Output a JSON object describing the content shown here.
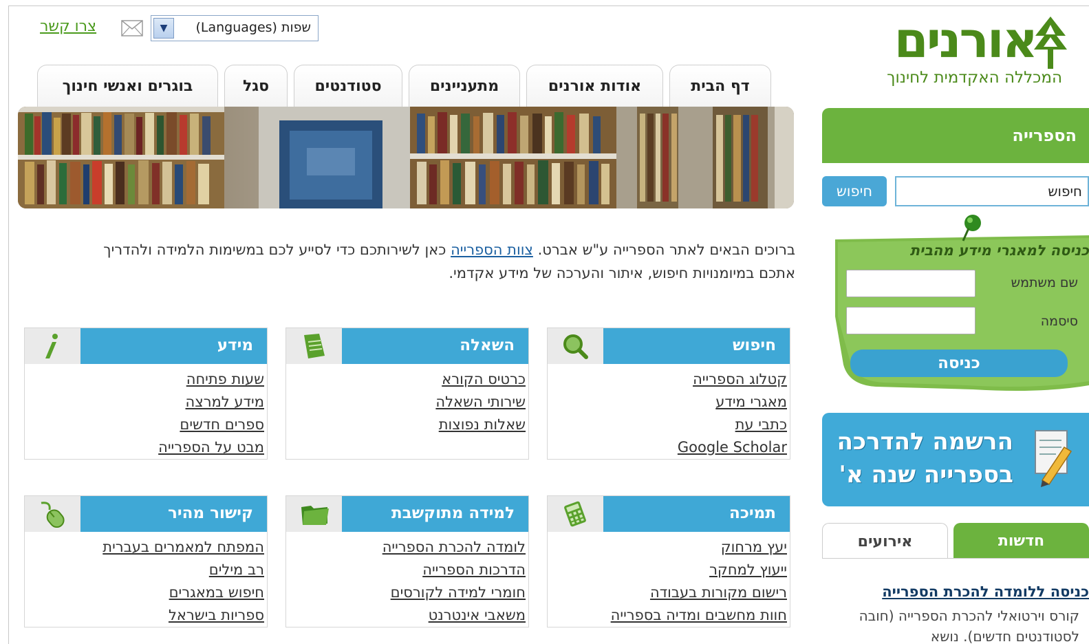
{
  "brand": {
    "logo_text": "אורנים",
    "tagline": "המכללה האקדמית לחינוך",
    "colors": {
      "green": "#6cb33e",
      "blue": "#3fa8d6",
      "dark_green": "#4b8a1a"
    }
  },
  "topbar": {
    "language_select": "שפות (Languages)",
    "contact_link": "צרו קשר",
    "mail_icon": "envelope-icon"
  },
  "nav": {
    "tabs": [
      "דף הבית",
      "אודות אורנים",
      "מתעניינים",
      "סטודנטים",
      "סגל",
      "בוגרים ואנשי חינוך"
    ]
  },
  "sidebar": {
    "section_title": "הספרייה",
    "search": {
      "value": "חיפוש",
      "button": "חיפוש"
    },
    "login": {
      "title": "כניסה למאגרי מידע מהבית",
      "username_label": "שם משתמש",
      "password_label": "סיסמה",
      "button": "כניסה"
    },
    "register_banner": {
      "line1": "הרשמה להדרכה",
      "line2": "בספרייה שנה א'"
    },
    "news_tabs": [
      "חדשות",
      "אירועים"
    ],
    "news": {
      "headline": "כניסה ללומדה להכרת הספרייה",
      "text": "קורס וירטואלי להכרת הספרייה (חובה לסטודנטים חדשים). נושא"
    }
  },
  "welcome": {
    "part1": "ברוכים הבאים לאתר הספרייה ע\"ש אברט.",
    "link": "צוות הספרייה",
    "part2": "כאן לשירותכם כדי לסייע לכם במשימות הלמידה ולהדריך אתכם במיומנויות חיפוש, איתור והערכה של מידע אקדמי."
  },
  "boxes": [
    {
      "title": "חיפוש",
      "icon": "magnifier-icon",
      "links": [
        "קטלוג הספרייה",
        "מאגרי מידע",
        "כתבי עת",
        "Google Scholar"
      ]
    },
    {
      "title": "השאלה",
      "icon": "document-icon",
      "links": [
        "כרטיס הקורא",
        "שירותי השאלה",
        "שאלות נפוצות"
      ]
    },
    {
      "title": "מידע",
      "icon": "info-icon",
      "links": [
        "שעות פתיחה",
        "מידע למרצה",
        "ספרים חדשים",
        "מבט על הספרייה"
      ]
    },
    {
      "title": "תמיכה",
      "icon": "calculator-icon",
      "links": [
        "יעץ מרחוק",
        "ייעוץ למחקר",
        "רישום מקורות בעבודה",
        "חוות מחשבים ומדיה בספרייה"
      ]
    },
    {
      "title": "למידה מתוקשבת",
      "icon": "folder-icon",
      "links": [
        "לומדה להכרת הספרייה",
        "הדרכות הספרייה",
        "חומרי למידה לקורסים",
        "משאבי אינטרנט"
      ]
    },
    {
      "title": "קישור מהיר",
      "icon": "mouse-icon",
      "links": [
        "המפתח למאמרים בעברית",
        "רב מילים",
        "חיפוש במאגרים",
        "ספריות בישראל"
      ]
    }
  ]
}
